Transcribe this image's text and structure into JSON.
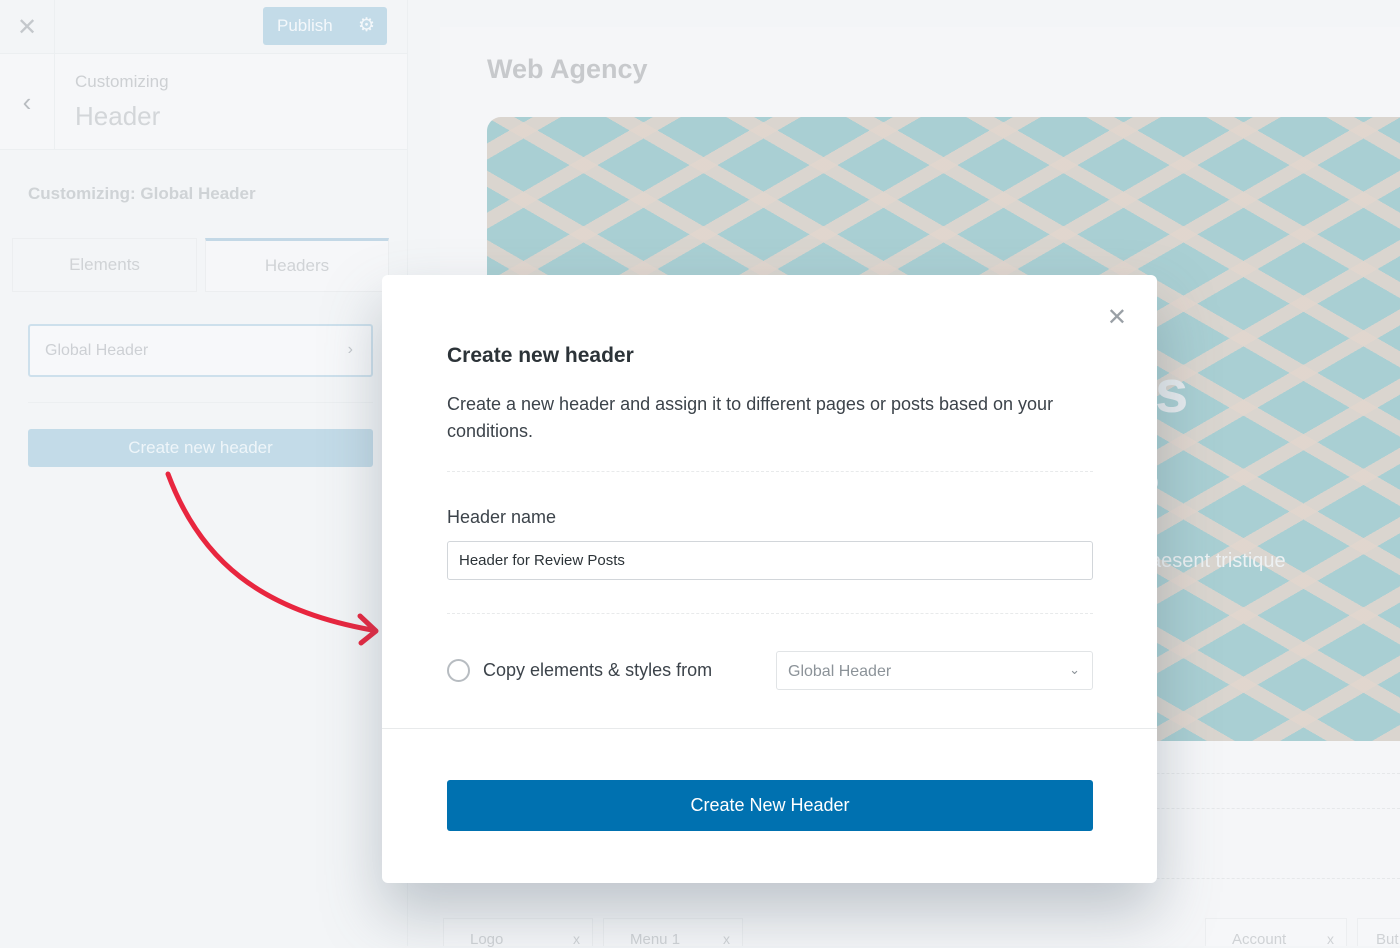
{
  "sidebar": {
    "close_icon": "close-icon",
    "publish_label": "Publish",
    "settings_icon": "gear-icon",
    "back_icon": "chevron-left-icon",
    "breadcrumb_small": "Customizing",
    "breadcrumb_title": "Header",
    "section_title": "Customizing: Global Header",
    "tabs": [
      {
        "label": "Elements"
      },
      {
        "label": "Headers",
        "active": true
      }
    ],
    "header_item": "Global Header",
    "create_button": "Create new header"
  },
  "preview": {
    "site_title": "Web Agency",
    "hero_fragments": [
      "ts",
      "s",
      "aesent tristique"
    ],
    "bottom_chips": [
      "Logo",
      "Menu 1",
      "Account",
      "But"
    ]
  },
  "modal": {
    "title": "Create new header",
    "description": "Create a new header and assign it to different pages or posts based on your conditions.",
    "name_label": "Header name",
    "name_value": "Header for Review Posts",
    "copy_label": "Copy elements & styles from",
    "copy_checked": false,
    "copy_select_value": "Global Header",
    "submit_label": "Create New Header",
    "accent": "#0071b0"
  }
}
